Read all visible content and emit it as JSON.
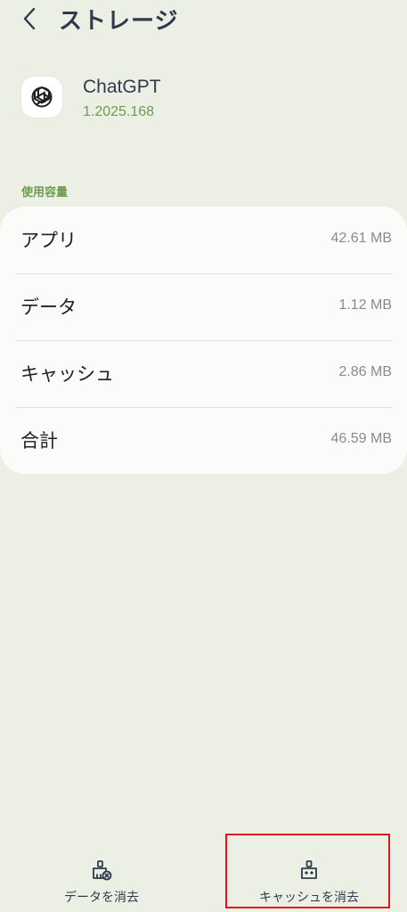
{
  "header": {
    "title": "ストレージ"
  },
  "app": {
    "name": "ChatGPT",
    "version": "1.2025.168"
  },
  "storage": {
    "section_label": "使用容量",
    "rows": [
      {
        "label": "アプリ",
        "value": "42.61 MB"
      },
      {
        "label": "データ",
        "value": "1.12 MB"
      },
      {
        "label": "キャッシュ",
        "value": "2.86 MB"
      },
      {
        "label": "合計",
        "value": "46.59 MB"
      }
    ]
  },
  "bottom_bar": {
    "clear_data_label": "データを消去",
    "clear_cache_label": "キャッシュを消去"
  },
  "colors": {
    "background": "#ecf0e4",
    "accent_green": "#6e9c4f",
    "title_navy": "#2f3b4c",
    "highlight_red": "#e0141e"
  },
  "icons": {
    "back": "chevron-left-icon",
    "app": "chatgpt-logo-icon",
    "clear_data": "brush-clear-data-icon",
    "clear_cache": "brush-clear-cache-icon"
  }
}
